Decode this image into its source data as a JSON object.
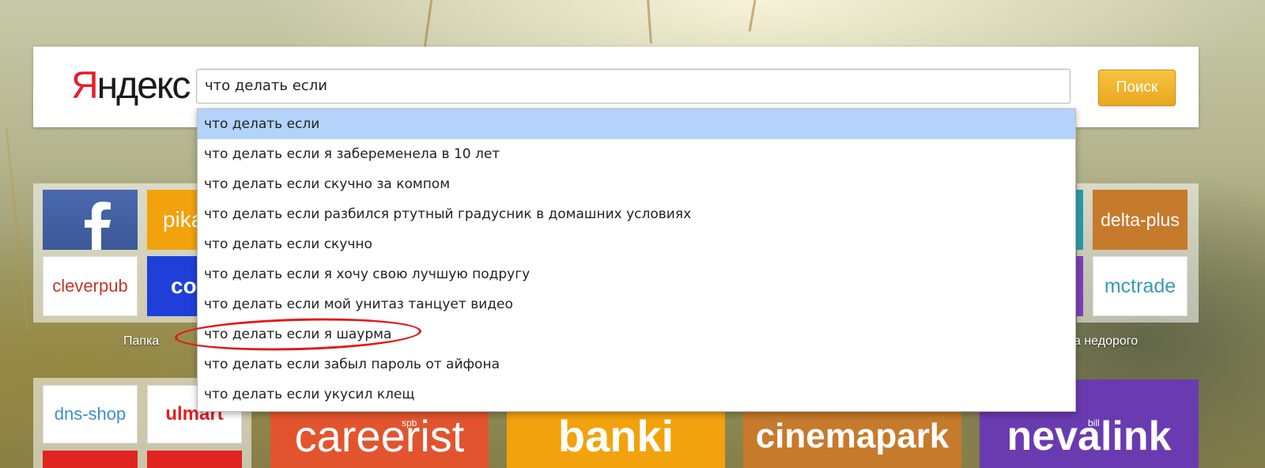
{
  "header": {
    "logo_first": "Я",
    "logo_rest": "ндекс",
    "search_value": "что делать если",
    "search_button": "Поиск"
  },
  "suggestions": [
    "что делать если",
    "что делать если я забеременела в 10 лет",
    "что делать если скучно за компом",
    "что делать если разбился ртутный градусник в домашних условиях",
    "что делать если скучно",
    "что делать если я хочу свою лучшую подругу",
    "что делать если мой унитаз танцует видео",
    "что делать если я шаурма",
    "что делать если забыл пароль от айфона",
    "что делать если укусил клещ"
  ],
  "tiles_left": {
    "folder_label": "Папка",
    "pikabu": "pika",
    "cleverpub": "cleverpub",
    "coub": "cou"
  },
  "tiles_right": {
    "delta_plus": "delta-plus",
    "mctrade": "mctrade",
    "group_label": "а недорого"
  },
  "tiles_bottom": {
    "dns_shop": "dns-shop",
    "ulmart": "ulmart",
    "careerist": "careerist",
    "careerist_sup": "spb",
    "banki": "banki",
    "cinemapark": "cinemapark",
    "nevalink": "nevalink",
    "nevalink_sup": "bill"
  },
  "colors": {
    "selected_suggestion": "#b3d3fb",
    "search_button": "#f0b72f",
    "annotation_circle": "#e01b1b",
    "facebook": "#3b5998",
    "careerist": "#e2542e",
    "banki": "#f2a20c",
    "cinemapark": "#c67a2c",
    "nevalink": "#6a3bb0"
  }
}
